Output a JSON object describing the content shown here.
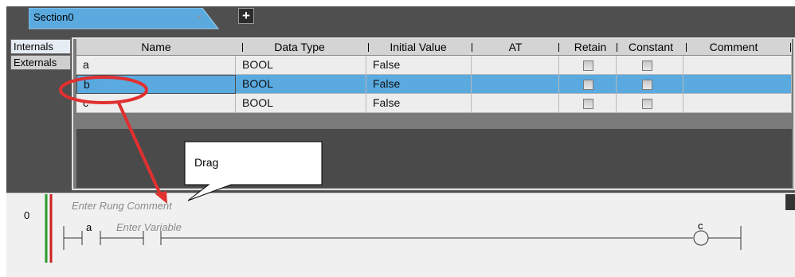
{
  "tab": {
    "label": "Section0",
    "close": "×",
    "add": "+"
  },
  "side_tabs": [
    "Internals",
    "Externals"
  ],
  "columns": [
    "Name",
    "Data Type",
    "Initial Value",
    "AT",
    "Retain",
    "Constant",
    "Comment"
  ],
  "rows": [
    {
      "name": "a",
      "type": "BOOL",
      "initial": "False",
      "at": "",
      "retain": false,
      "constant": false,
      "comment": ""
    },
    {
      "name": "b",
      "type": "BOOL",
      "initial": "False",
      "at": "",
      "retain": false,
      "constant": false,
      "comment": "",
      "selected": true
    },
    {
      "name": "c",
      "type": "BOOL",
      "initial": "False",
      "at": "",
      "retain": false,
      "constant": false,
      "comment": ""
    }
  ],
  "callout": {
    "text": "Drag"
  },
  "ladder": {
    "rung_number": "0",
    "rung_comment_placeholder": "Enter Rung Comment",
    "contact_label": "a",
    "enter_variable_placeholder": "Enter Variable",
    "coil_label": "c"
  },
  "colors": {
    "tab": "#5aaae0",
    "selected_row": "#5aaae0",
    "annotation": "#e03030"
  }
}
